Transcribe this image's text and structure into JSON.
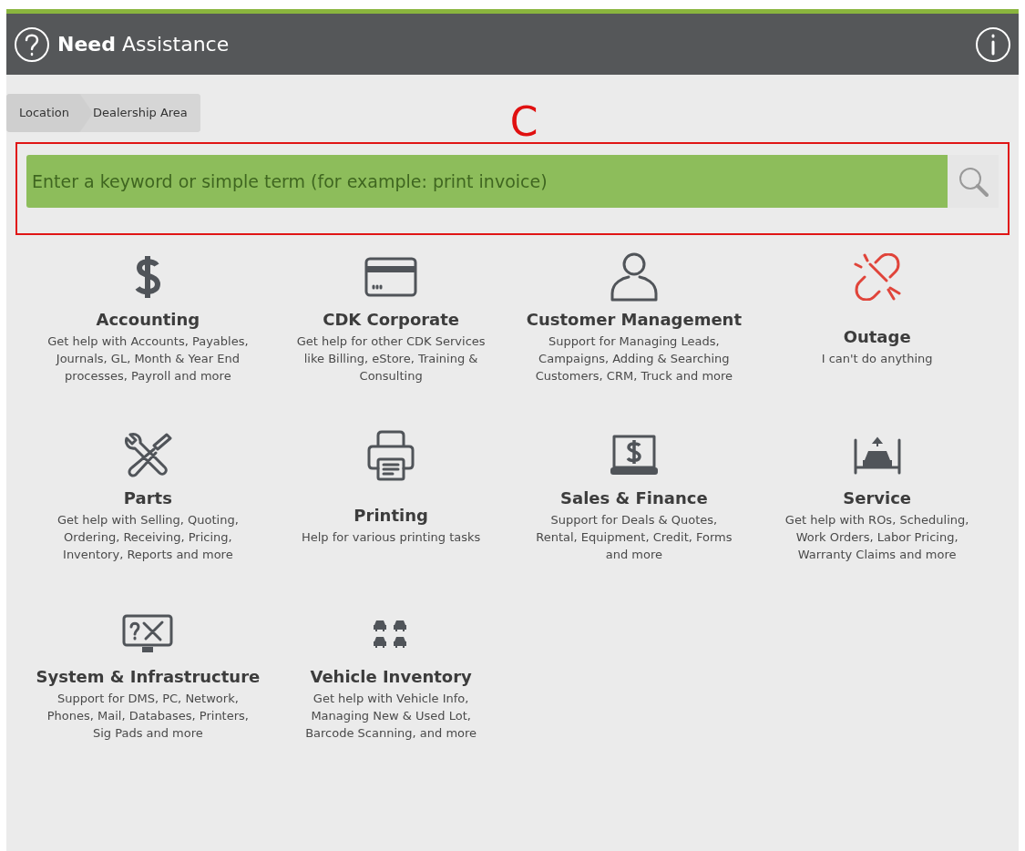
{
  "header": {
    "title_bold": "Need",
    "title_rest": "Assistance"
  },
  "breadcrumb": [
    "Location",
    "Dealership Area"
  ],
  "annotation": {
    "label": "C"
  },
  "search": {
    "placeholder": "Enter a keyword or simple term (for example: print invoice)"
  },
  "tiles": [
    {
      "title": "Accounting",
      "description": "Get help with Accounts, Payables,\nJournals, GL, Month & Year End\nprocesses, Payroll and more",
      "color": "#505459"
    },
    {
      "title": "CDK Corporate",
      "description": "Get help for other CDK Services\nlike Billing, eStore, Training &\nConsulting",
      "color": "#505459"
    },
    {
      "title": "Customer Management",
      "description": "Support for Managing Leads,\nCampaigns, Adding & Searching\nCustomers, CRM, Truck and more",
      "color": "#505459"
    },
    {
      "title": "Outage",
      "description": "I can't do anything",
      "color": "#e0443a"
    },
    {
      "title": "Parts",
      "description": "Get help with Selling, Quoting,\nOrdering, Receiving, Pricing,\nInventory, Reports and more",
      "color": "#505459"
    },
    {
      "title": "Printing",
      "description": "Help for various printing tasks",
      "color": "#505459"
    },
    {
      "title": "Sales & Finance",
      "description": "Support for Deals & Quotes,\nRental, Equipment, Credit, Forms\nand more",
      "color": "#505459"
    },
    {
      "title": "Service",
      "description": "Get help with ROs, Scheduling,\nWork Orders, Labor Pricing,\nWarranty Claims and more",
      "color": "#505459"
    },
    {
      "title": "System & Infrastructure",
      "description": "Support for DMS, PC, Network,\nPhones, Mail, Databases, Printers,\nSig Pads and more",
      "color": "#505459"
    },
    {
      "title": "Vehicle Inventory",
      "description": "Get help with Vehicle Info,\nManaging New & Used Lot,\nBarcode Scanning, and more",
      "color": "#505459"
    }
  ]
}
